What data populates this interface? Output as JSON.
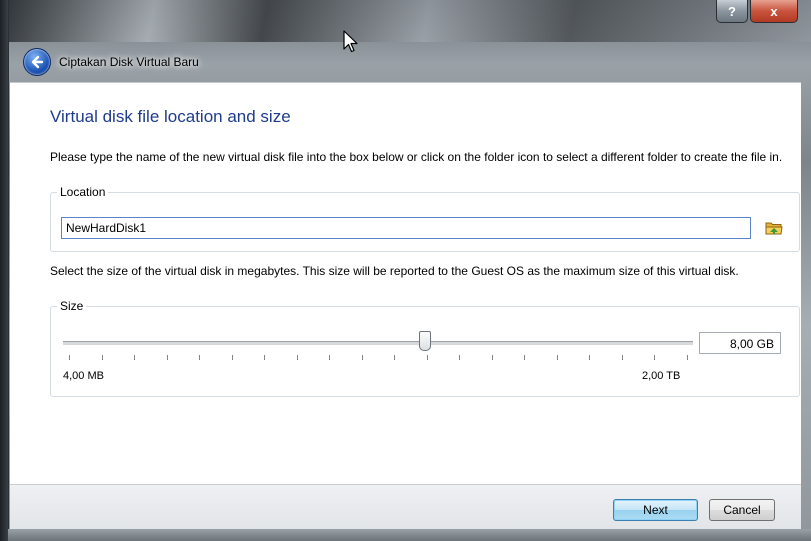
{
  "window": {
    "title": "Ciptakan Disk Virtual Baru",
    "help_label": "?",
    "close_label": "x"
  },
  "page": {
    "heading": "Virtual disk file location and size",
    "location_description": "Please type the name of the new virtual disk file into the box below or click on the folder icon to select a different folder to create the file in.",
    "size_description": "Select the size of the virtual disk in megabytes. This size will be reported to the Guest OS as the maximum size of this virtual disk."
  },
  "location": {
    "legend": "Location",
    "value": "NewHardDisk1",
    "folder_icon": "folder-browse-icon"
  },
  "size": {
    "legend": "Size",
    "min_label": "4,00 MB",
    "max_label": "2,00 TB",
    "value_text": "8,00 GB",
    "slider_fraction": 0.575,
    "tick_count": 20
  },
  "buttons": {
    "next": "Next",
    "cancel": "Cancel"
  },
  "colors": {
    "heading": "#1f3b8c",
    "default_button": "#98d1ef",
    "close_button": "#c9533d"
  }
}
